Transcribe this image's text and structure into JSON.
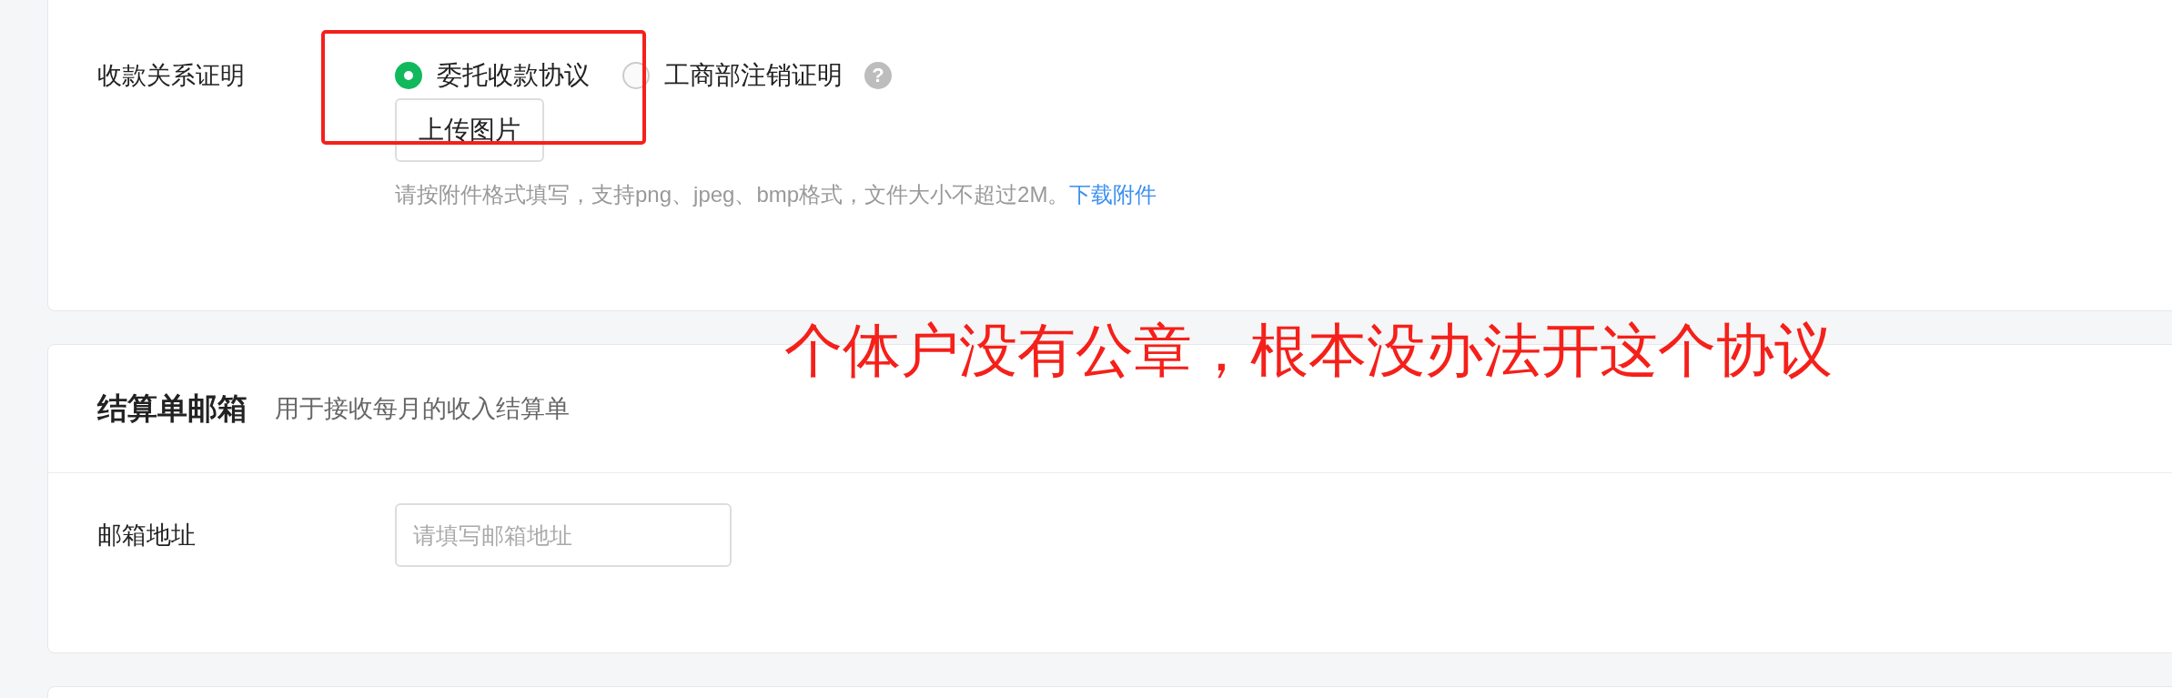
{
  "proof_row": {
    "label": "收款关系证明",
    "options": [
      {
        "label": "委托收款协议",
        "selected": true
      },
      {
        "label": "工商部注销证明",
        "selected": false,
        "help": "?"
      }
    ],
    "upload_button": "上传图片",
    "hint": "请按附件格式填写，支持png、jpeg、bmp格式，文件大小不超过2M。",
    "hint_link": "下载附件"
  },
  "email_section": {
    "title": "结算单邮箱",
    "subtitle": "用于接收每月的收入结算单",
    "field_label": "邮箱地址",
    "placeholder": "请填写邮箱地址"
  },
  "annotation": {
    "text": "个体户没有公章，根本没办法开这个协议"
  }
}
